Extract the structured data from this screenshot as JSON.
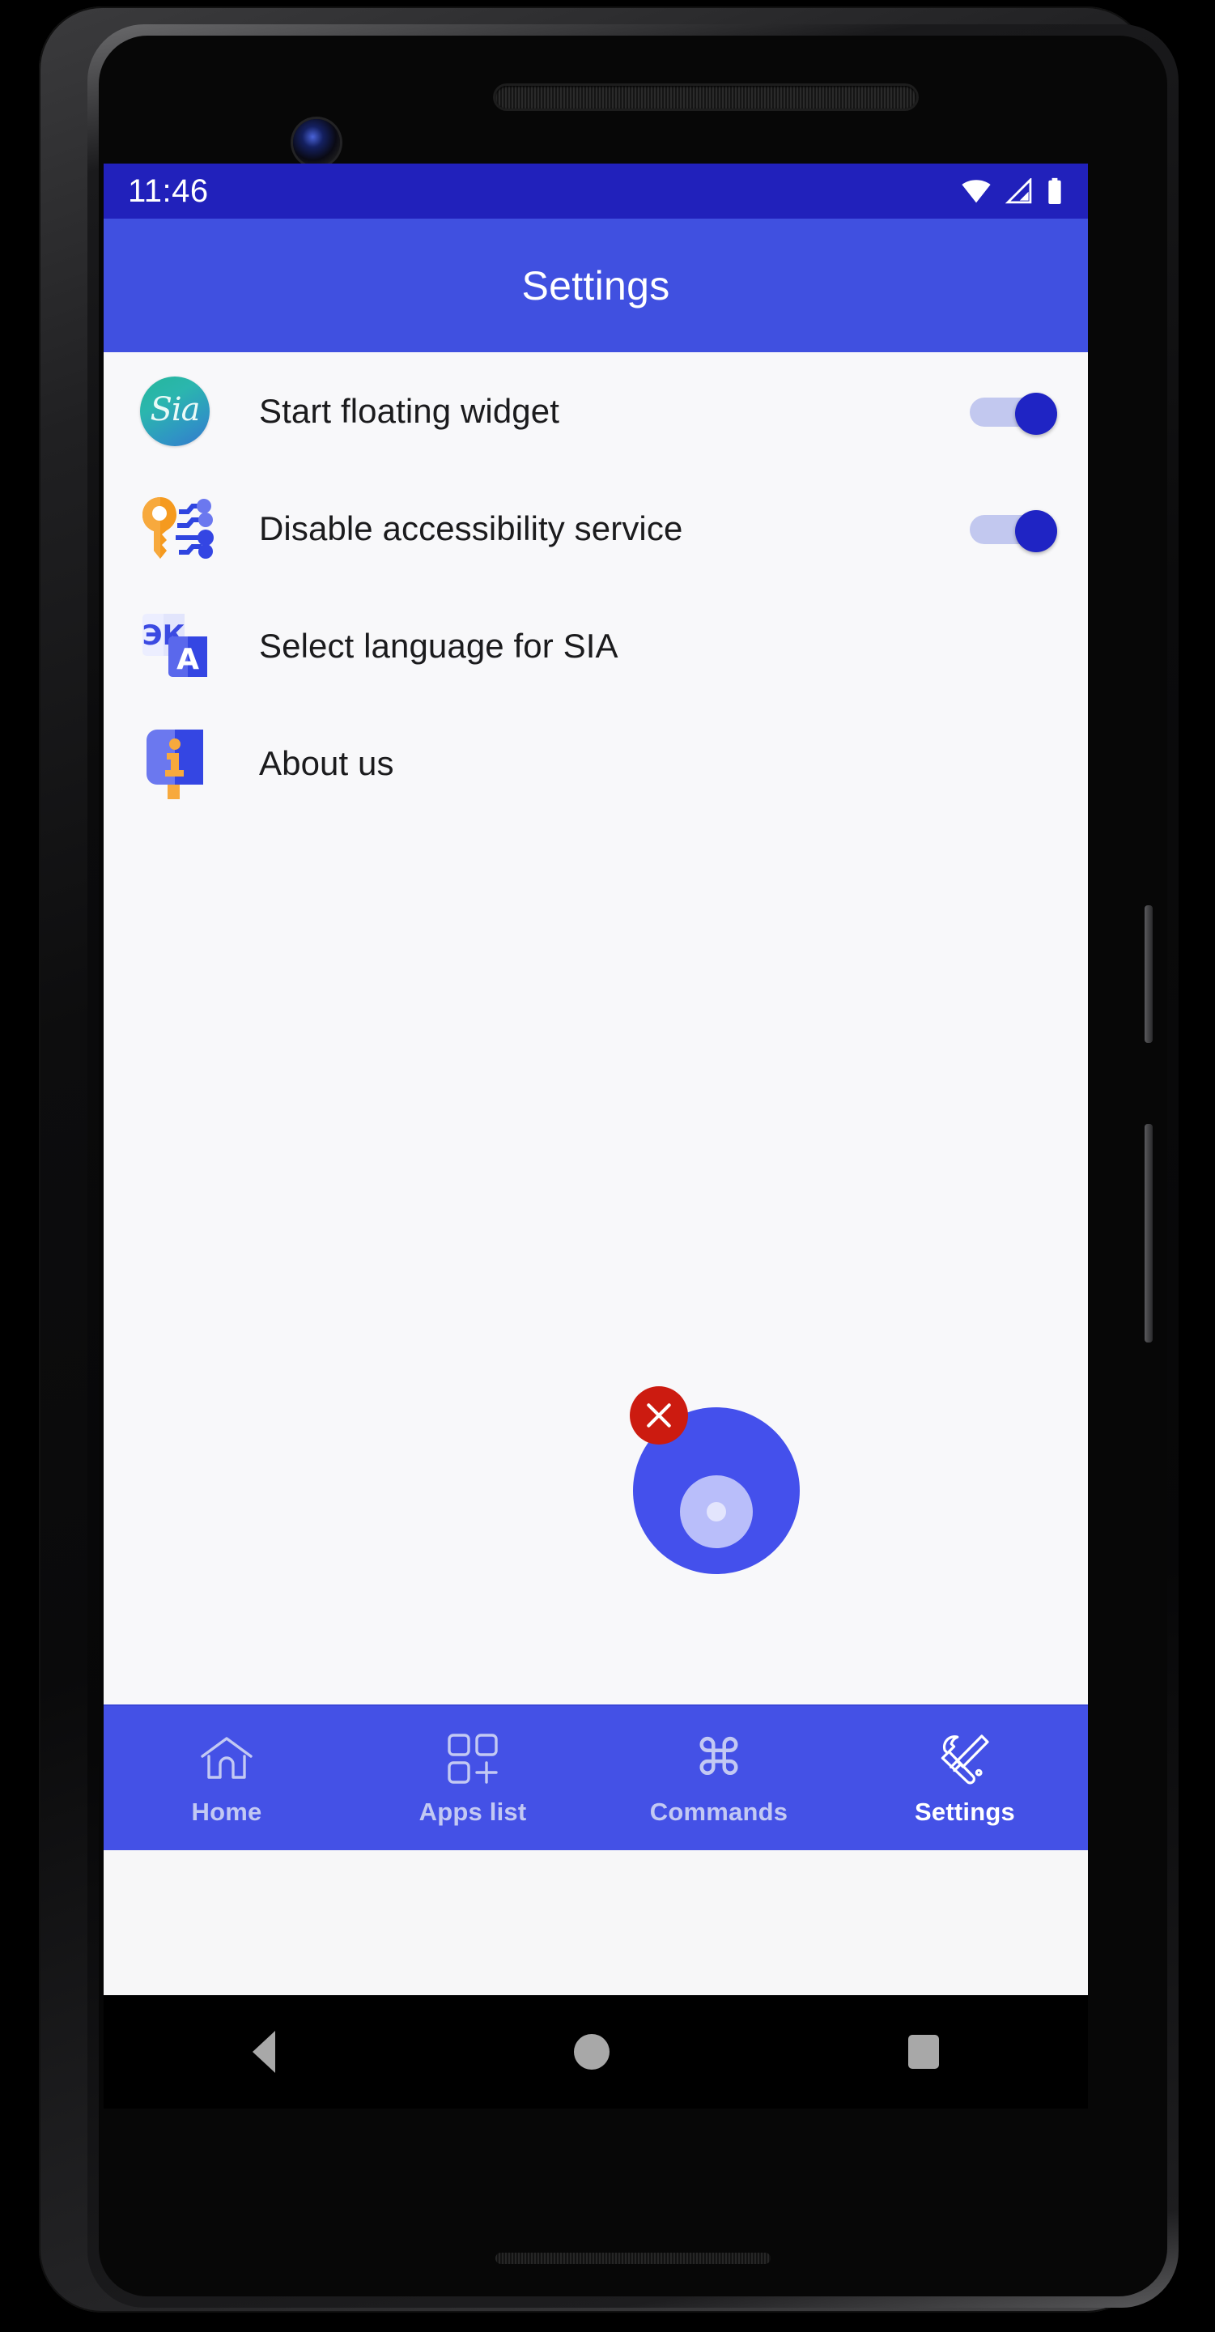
{
  "device": {
    "type": "android-phone-mockup"
  },
  "status_bar": {
    "time": "11:46",
    "icons": [
      "wifi-icon",
      "cellular-signal-icon",
      "battery-icon"
    ],
    "background": "#2121bb"
  },
  "app_bar": {
    "title": "Settings",
    "background": "#4050e0"
  },
  "settings": {
    "rows": [
      {
        "label": "Start floating widget",
        "icon": "sia-logo-icon",
        "control": "toggle",
        "toggle_on": true
      },
      {
        "label": "Disable accessibility service",
        "icon": "key-circuit-icon",
        "control": "toggle",
        "toggle_on": true
      },
      {
        "label": "Select language for SIA",
        "icon": "translate-icon",
        "control": "none",
        "toggle_on": null
      },
      {
        "label": "About us",
        "icon": "info-sign-icon",
        "control": "none",
        "toggle_on": null
      }
    ],
    "sia_badge_text": "Sia"
  },
  "floating_widget": {
    "close_glyph": "✕",
    "bubble_color": "#4450ec",
    "close_color": "#cc1b10"
  },
  "bottom_nav": {
    "items": [
      {
        "label": "Home",
        "icon": "home-icon",
        "active": false
      },
      {
        "label": "Apps list",
        "icon": "apps-grid-plus-icon",
        "active": false
      },
      {
        "label": "Commands",
        "icon": "command-key-icon",
        "active": false,
        "glyph": "⌘"
      },
      {
        "label": "Settings",
        "icon": "tools-icon",
        "active": true
      }
    ],
    "background": "#4451e6",
    "active_color": "#ffffff",
    "inactive_color": "#c3c9f3"
  },
  "system_nav": {
    "buttons": [
      "back-button",
      "home-button",
      "recents-button"
    ]
  }
}
